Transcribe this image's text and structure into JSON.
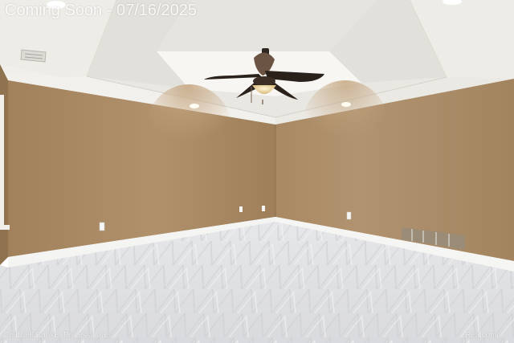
{
  "photo": {
    "banner_text": "Coming Soon - 07/16/2025",
    "watermark_left": "Coldwell Banker Professionals",
    "watermark_right": "Realcomp"
  },
  "colors": {
    "wall": "#a98a64",
    "wall_shadow": "#8f7250",
    "ceiling": "#f3f1ec",
    "carpet": "#e3e4e5",
    "baseboard": "#f5f5f3",
    "fan": "#2e2620"
  }
}
